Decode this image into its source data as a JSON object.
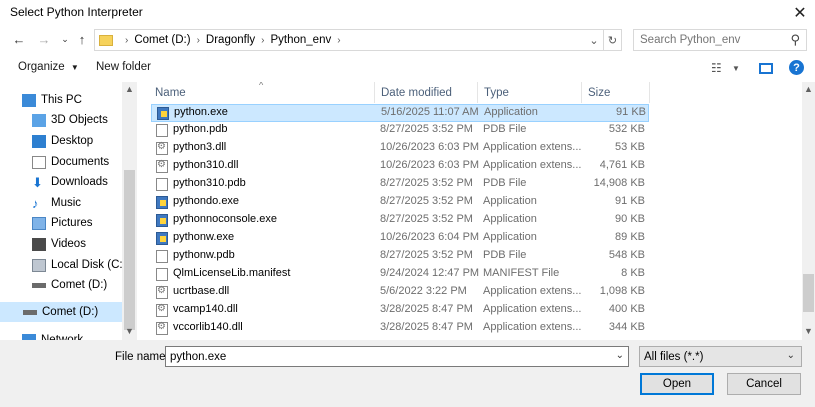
{
  "window": {
    "title": "Select Python Interpreter"
  },
  "nav": {
    "breadcrumbs": [
      "Comet (D:)",
      "Dragonfly",
      "Python_env"
    ],
    "search_placeholder": "Search Python_env"
  },
  "toolbar": {
    "organize_label": "Organize",
    "new_folder_label": "New folder"
  },
  "sidebar": {
    "items": [
      {
        "label": "This PC"
      },
      {
        "label": "3D Objects"
      },
      {
        "label": "Desktop"
      },
      {
        "label": "Documents"
      },
      {
        "label": "Downloads"
      },
      {
        "label": "Music"
      },
      {
        "label": "Pictures"
      },
      {
        "label": "Videos"
      },
      {
        "label": "Local Disk (C:)"
      },
      {
        "label": "Comet (D:)"
      },
      {
        "label": "Comet (D:)"
      },
      {
        "label": "Network"
      }
    ]
  },
  "columns": {
    "name": "Name",
    "date": "Date modified",
    "type": "Type",
    "size": "Size"
  },
  "files": [
    {
      "name": "python.exe",
      "date": "5/16/2025 11:07 AM",
      "type": "Application",
      "size": "91 KB"
    },
    {
      "name": "python.pdb",
      "date": "8/27/2025 3:52 PM",
      "type": "PDB File",
      "size": "532 KB"
    },
    {
      "name": "python3.dll",
      "date": "10/26/2023 6:03 PM",
      "type": "Application extens...",
      "size": "53 KB"
    },
    {
      "name": "python310.dll",
      "date": "10/26/2023 6:03 PM",
      "type": "Application extens...",
      "size": "4,761 KB"
    },
    {
      "name": "python310.pdb",
      "date": "8/27/2025 3:52 PM",
      "type": "PDB File",
      "size": "14,908 KB"
    },
    {
      "name": "pythondo.exe",
      "date": "8/27/2025 3:52 PM",
      "type": "Application",
      "size": "91 KB"
    },
    {
      "name": "pythonnoconsole.exe",
      "date": "8/27/2025 3:52 PM",
      "type": "Application",
      "size": "90 KB"
    },
    {
      "name": "pythonw.exe",
      "date": "10/26/2023 6:04 PM",
      "type": "Application",
      "size": "89 KB"
    },
    {
      "name": "pythonw.pdb",
      "date": "8/27/2025 3:52 PM",
      "type": "PDB File",
      "size": "548 KB"
    },
    {
      "name": "QlmLicenseLib.manifest",
      "date": "9/24/2024 12:47 PM",
      "type": "MANIFEST File",
      "size": "8 KB"
    },
    {
      "name": "ucrtbase.dll",
      "date": "5/6/2022 3:22 PM",
      "type": "Application extens...",
      "size": "1,098 KB"
    },
    {
      "name": "vcamp140.dll",
      "date": "3/28/2025 8:47 PM",
      "type": "Application extens...",
      "size": "400 KB"
    },
    {
      "name": "vccorlib140.dll",
      "date": "3/28/2025 8:47 PM",
      "type": "Application extens...",
      "size": "344 KB"
    }
  ],
  "footer": {
    "filename_label": "File name:",
    "filename_value": "python.exe",
    "filter_value": "All files (*.*)",
    "open_label": "Open",
    "cancel_label": "Cancel"
  }
}
